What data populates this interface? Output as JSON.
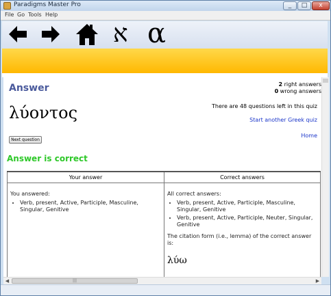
{
  "window": {
    "title": "Paradigms Master Pro",
    "minimize": "_",
    "maximize": "□",
    "close": "x"
  },
  "menu": [
    "File",
    "Go",
    "Tools",
    "Help"
  ],
  "toolbar": {
    "back_icon": "arrow-left-icon",
    "forward_icon": "arrow-right-icon",
    "home_icon": "home-icon",
    "hebrew_label": "א",
    "greek_label": "α"
  },
  "main": {
    "heading": "Answer",
    "word": "λύοντος",
    "next_button": "Next question",
    "stats": {
      "right_count": "2",
      "right_label": " right answers",
      "wrong_count": "0",
      "wrong_label": " wrong answers"
    },
    "remaining": "There are 48 questions left in this quiz",
    "start_link": "Start another Greek quiz",
    "home_link": "Home",
    "result_banner": "Answer is correct",
    "result_color": "#2ec829"
  },
  "results": {
    "your_header": "Your answer",
    "correct_header": "Correct answers",
    "your_intro": "You answered:",
    "your_answers": [
      "Verb, present, Active, Participle, Masculine, Singular, Genitive"
    ],
    "correct_intro": "All correct answers:",
    "correct_answers": [
      "Verb, present, Active, Participle, Masculine, Singular, Genitive",
      "Verb, present, Active, Participle, Neuter, Singular, Genitive"
    ],
    "citation_text": "The citation form (i.e., lemma) of the correct answer is:",
    "lemma": "λύω"
  },
  "scrollbar": {
    "thumb_grip": "|||"
  },
  "colors": {
    "accent_heading": "#4a5a9c",
    "link": "#1a35c9",
    "banner_top": "#ffd84a",
    "banner_bottom": "#ffb800"
  }
}
